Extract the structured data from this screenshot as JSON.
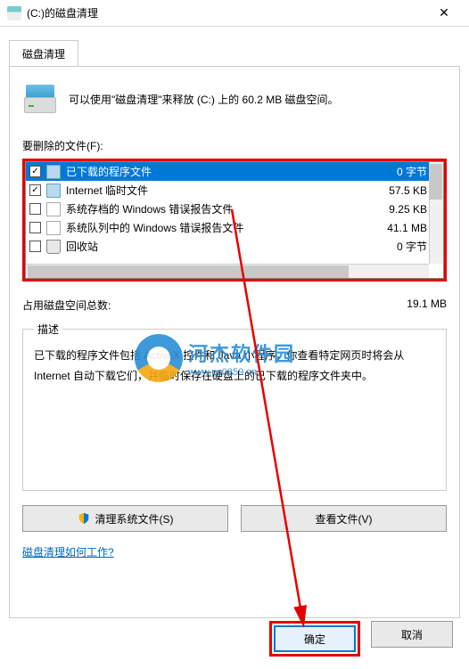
{
  "window": {
    "title": "(C:)的磁盘清理",
    "close": "✕"
  },
  "tab": {
    "label": "磁盘清理"
  },
  "info": "可以使用\"磁盘清理\"来释放  (C:) 上的 60.2 MB 磁盘空间。",
  "files_label": "要删除的文件(F):",
  "files": [
    {
      "checked": true,
      "selected": true,
      "icon": "file",
      "name": "已下载的程序文件",
      "size": "0 字节"
    },
    {
      "checked": true,
      "selected": false,
      "icon": "file",
      "name": "Internet 临时文件",
      "size": "57.5 KB"
    },
    {
      "checked": false,
      "selected": false,
      "icon": "generic",
      "name": "系统存档的 Windows 错误报告文件",
      "size": "9.25 KB"
    },
    {
      "checked": false,
      "selected": false,
      "icon": "generic",
      "name": "系统队列中的 Windows 错误报告文件",
      "size": "41.1 MB"
    },
    {
      "checked": false,
      "selected": false,
      "icon": "recycle",
      "name": "回收站",
      "size": "0 字节"
    }
  ],
  "total": {
    "label": "占用磁盘空间总数:",
    "value": "19.1 MB"
  },
  "desc": {
    "legend": "描述",
    "body": "已下载的程序文件包括 ActiveX 控件和 Java 小程序，你查看特定网页时将会从 Internet 自动下载它们，并临时保存在硬盘上的已下载的程序文件夹中。"
  },
  "buttons": {
    "clean": "清理系统文件(S)",
    "view": "查看文件(V)",
    "ok": "确定",
    "cancel": "取消"
  },
  "help_link": "磁盘清理如何工作?",
  "watermark": {
    "line1": "河杰软件园",
    "line2": "www.pc0359.cn"
  }
}
